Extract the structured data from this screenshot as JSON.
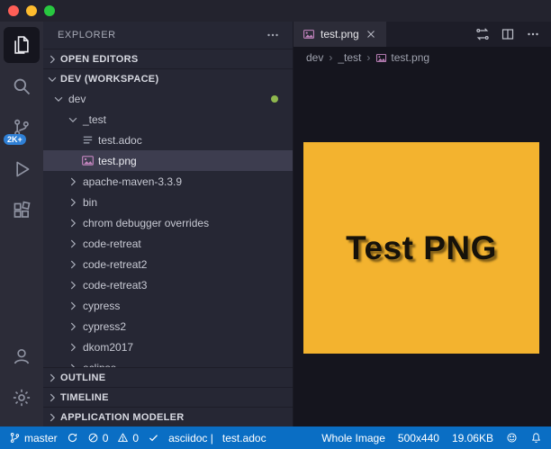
{
  "window": {
    "traffic_lights": [
      "#ff5f57",
      "#febc2e",
      "#28c840"
    ]
  },
  "activity_bar": {
    "badge_color": "#2f80d6",
    "items": [
      {
        "name": "explorer",
        "icon": "files",
        "active": true
      },
      {
        "name": "search",
        "icon": "search",
        "active": false
      },
      {
        "name": "source-control",
        "icon": "branch",
        "active": false,
        "badge": "2K+"
      },
      {
        "name": "run-debug",
        "icon": "debug",
        "active": false
      },
      {
        "name": "extensions",
        "icon": "extensions",
        "active": false
      }
    ],
    "bottom_items": [
      {
        "name": "account",
        "icon": "account"
      },
      {
        "name": "settings",
        "icon": "gear"
      }
    ]
  },
  "sidebar": {
    "title": "EXPLORER",
    "open_editors": {
      "label": "OPEN EDITORS",
      "expanded": false
    },
    "workspace": {
      "label": "DEV (WORKSPACE)",
      "expanded": true
    },
    "modified_dot_color": "#8fb84e",
    "tree": [
      {
        "label": "dev",
        "kind": "folder",
        "depth": 0,
        "expanded": true,
        "has_dot": true
      },
      {
        "label": "_test",
        "kind": "folder",
        "depth": 1,
        "expanded": true
      },
      {
        "label": "test.adoc",
        "kind": "file",
        "icon": "adoc",
        "depth": 2
      },
      {
        "label": "test.png",
        "kind": "file",
        "icon": "image",
        "depth": 2,
        "selected": true
      },
      {
        "label": "apache-maven-3.3.9",
        "kind": "folder",
        "depth": 1,
        "expanded": false
      },
      {
        "label": "bin",
        "kind": "folder",
        "depth": 1,
        "expanded": false
      },
      {
        "label": "chrom debugger overrides",
        "kind": "folder",
        "depth": 1,
        "expanded": false
      },
      {
        "label": "code-retreat",
        "kind": "folder",
        "depth": 1,
        "expanded": false
      },
      {
        "label": "code-retreat2",
        "kind": "folder",
        "depth": 1,
        "expanded": false
      },
      {
        "label": "code-retreat3",
        "kind": "folder",
        "depth": 1,
        "expanded": false
      },
      {
        "label": "cypress",
        "kind": "folder",
        "depth": 1,
        "expanded": false
      },
      {
        "label": "cypress2",
        "kind": "folder",
        "depth": 1,
        "expanded": false
      },
      {
        "label": "dkom2017",
        "kind": "folder",
        "depth": 1,
        "expanded": false
      },
      {
        "label": "eclipse",
        "kind": "folder",
        "depth": 1,
        "expanded": false
      }
    ],
    "panels": [
      {
        "label": "OUTLINE"
      },
      {
        "label": "TIMELINE"
      },
      {
        "label": "APPLICATION MODELER"
      }
    ]
  },
  "editor": {
    "tabs": [
      {
        "label": "test.png",
        "icon": "image",
        "active": true
      }
    ],
    "tab_actions": [
      "open-changes",
      "split-editor",
      "more-actions"
    ],
    "breadcrumb_separator": "›",
    "breadcrumbs": [
      {
        "label": "dev"
      },
      {
        "label": "_test"
      },
      {
        "label": "test.png",
        "icon": "image"
      }
    ],
    "preview": {
      "text": "Test PNG",
      "background": "#f3b32f",
      "text_color": "#16120a"
    }
  },
  "status_bar": {
    "background": "#0a6ec4",
    "left": [
      {
        "name": "git-branch",
        "icon": "branch",
        "label": "master"
      },
      {
        "name": "sync",
        "icon": "sync",
        "label": ""
      },
      {
        "name": "errors",
        "icon": "error",
        "label": "0"
      },
      {
        "name": "warnings",
        "icon": "warning",
        "label": "0"
      },
      {
        "name": "task-status",
        "icon": "check",
        "label": ""
      },
      {
        "name": "language-mode",
        "label": "asciidoc |"
      },
      {
        "name": "active-file",
        "label": "test.adoc"
      }
    ],
    "right": [
      {
        "name": "image-zoom",
        "label": "Whole Image"
      },
      {
        "name": "image-dimensions",
        "label": "500x440"
      },
      {
        "name": "image-size",
        "label": "19.06KB"
      },
      {
        "name": "feedback",
        "icon": "smiley",
        "label": ""
      },
      {
        "name": "notifications",
        "icon": "bell",
        "label": ""
      }
    ]
  }
}
